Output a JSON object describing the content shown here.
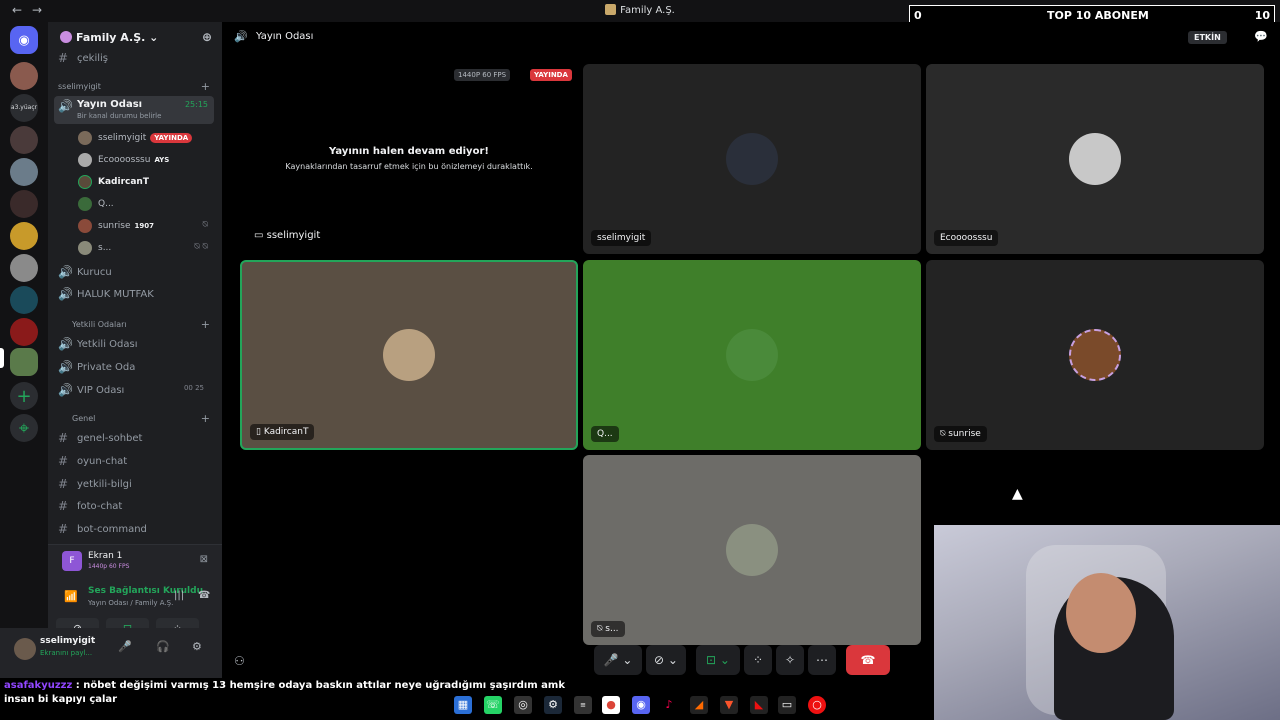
{
  "window": {
    "title": "Family A.Ş.",
    "back": "←",
    "forward": "→"
  },
  "overlay": {
    "left": "0",
    "title": "TOP 10 ABONEM",
    "right": "10"
  },
  "guild": {
    "name": "Family A.Ş.",
    "chevron": "⌄"
  },
  "channels": {
    "top_clip": "çekiliş",
    "cat_voice": "sselimyigit",
    "voice_active": {
      "name": "Yayın Odası",
      "timer": "25:15",
      "status": "Bir kanal durumu belirle"
    },
    "voice_users": [
      {
        "name": "sselimyigit",
        "badge": "YAYINDA"
      },
      {
        "name": "Ecoooosssu",
        "badge": "AYS"
      },
      {
        "name": "KadircanT",
        "badge": ""
      },
      {
        "name": "Q...",
        "badge": ""
      },
      {
        "name": "sunrise",
        "badge": "1907"
      },
      {
        "name": "s...",
        "badge": ""
      }
    ],
    "voice_more": [
      "Kurucu",
      "HALUK MUTFAK"
    ],
    "cat_staff": "Yetkili Odaları",
    "staff_channels": [
      {
        "name": "Yetkili Odası",
        "count": ""
      },
      {
        "name": "Private Oda",
        "count": ""
      },
      {
        "name": "VIP Odası",
        "count": "00 25"
      }
    ],
    "cat_general": "Genel",
    "text_channels": [
      "genel-sohbet",
      "oyun-chat",
      "yetkili-bilgi",
      "foto-chat",
      "bot-command"
    ]
  },
  "panel": {
    "stream_name": "Ekran 1",
    "stream_quality": "1440p 60 FPS",
    "conn_status": "Ses Bağlantısı Kuruldu",
    "conn_sub": "Yayın Odası / Family A.Ş."
  },
  "user": {
    "name": "sselimyigit",
    "status": "Ekranını payl..."
  },
  "main": {
    "channel": "Yayın Odası",
    "activity": "ETKİN",
    "stream_quality": "1440P 60 FPS",
    "stream_live": "YAYINDA",
    "stream_heading": "Yayının halen devam ediyor!",
    "stream_body": "Kaynaklarından tasarruf etmek için bu önizlemeyi duraklattık.",
    "stream_owner": "sselimyigit",
    "tiles": [
      "sselimyigit",
      "Ecoooosssu",
      "KadircanT",
      "Q...",
      "sunrise",
      "s..."
    ]
  },
  "chat": {
    "user": "asafakyuzzz",
    "message": ": nöbet değişimi varmış 13 hemşire odaya baskın attılar neye uğradığımı şaşırdım amk",
    "message2": "insan bi kapıyı çalar"
  },
  "colors": {
    "accent": "#5865f2",
    "green": "#23a55a",
    "red": "#da373c",
    "live": "#da373c"
  }
}
